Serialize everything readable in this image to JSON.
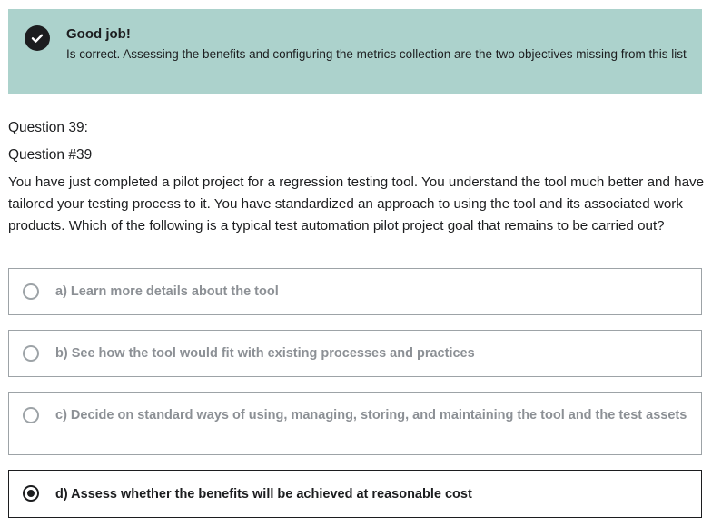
{
  "feedback": {
    "icon": "check-circle-icon",
    "title": "Good job!",
    "message": "Is correct. Assessing the benefits and configuring the metrics collection are the two objectives missing from this list",
    "background_color": "#acd2cc"
  },
  "question": {
    "number_label": "Question 39:",
    "id_label": "Question #39",
    "text": "You have just completed a pilot project for a regression testing tool. You understand the tool much better and have tailored your testing process to it. You have standardized an approach to using the tool and its associated work products. Which of the following is a typical test automation pilot project goal that remains to be carried out?"
  },
  "answers": [
    {
      "label": "a) Learn more details about the tool",
      "selected": false
    },
    {
      "label": "b) See how the tool would fit with existing processes and practices",
      "selected": false
    },
    {
      "label": "c) Decide on standard ways of using, managing, storing, and maintaining the tool and the test assets",
      "selected": false
    },
    {
      "label": "d) Assess whether the benefits will be achieved at reasonable cost",
      "selected": true
    }
  ]
}
